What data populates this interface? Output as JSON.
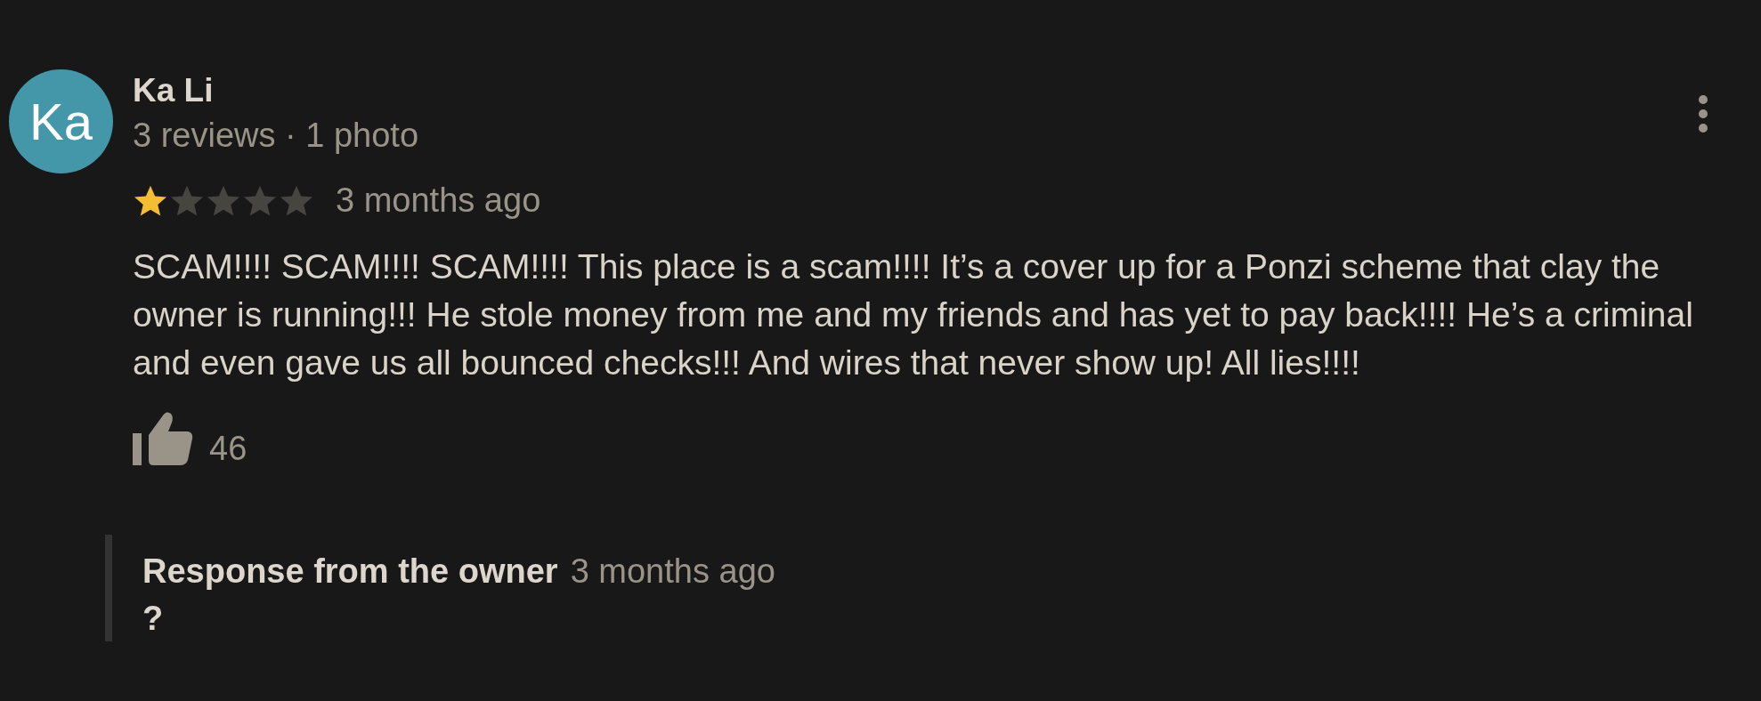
{
  "review": {
    "avatar_initials": "Ka",
    "author": "Ka Li",
    "author_meta": "3 reviews · 1 photo",
    "stars": 1,
    "time": "3 months ago",
    "text": "SCAM!!!! SCAM!!!! SCAM!!!! This place is a scam!!!! It’s a cover up for a Ponzi scheme that clay the owner is running!!! He stole money from me and my friends and has yet to pay back!!!! He’s a criminal and even gave us all bounced checks!!! And wires that never show up! All lies!!!!",
    "likes": "46"
  },
  "owner_response": {
    "title": "Response from the owner",
    "time": "3 months ago",
    "text": "?"
  }
}
